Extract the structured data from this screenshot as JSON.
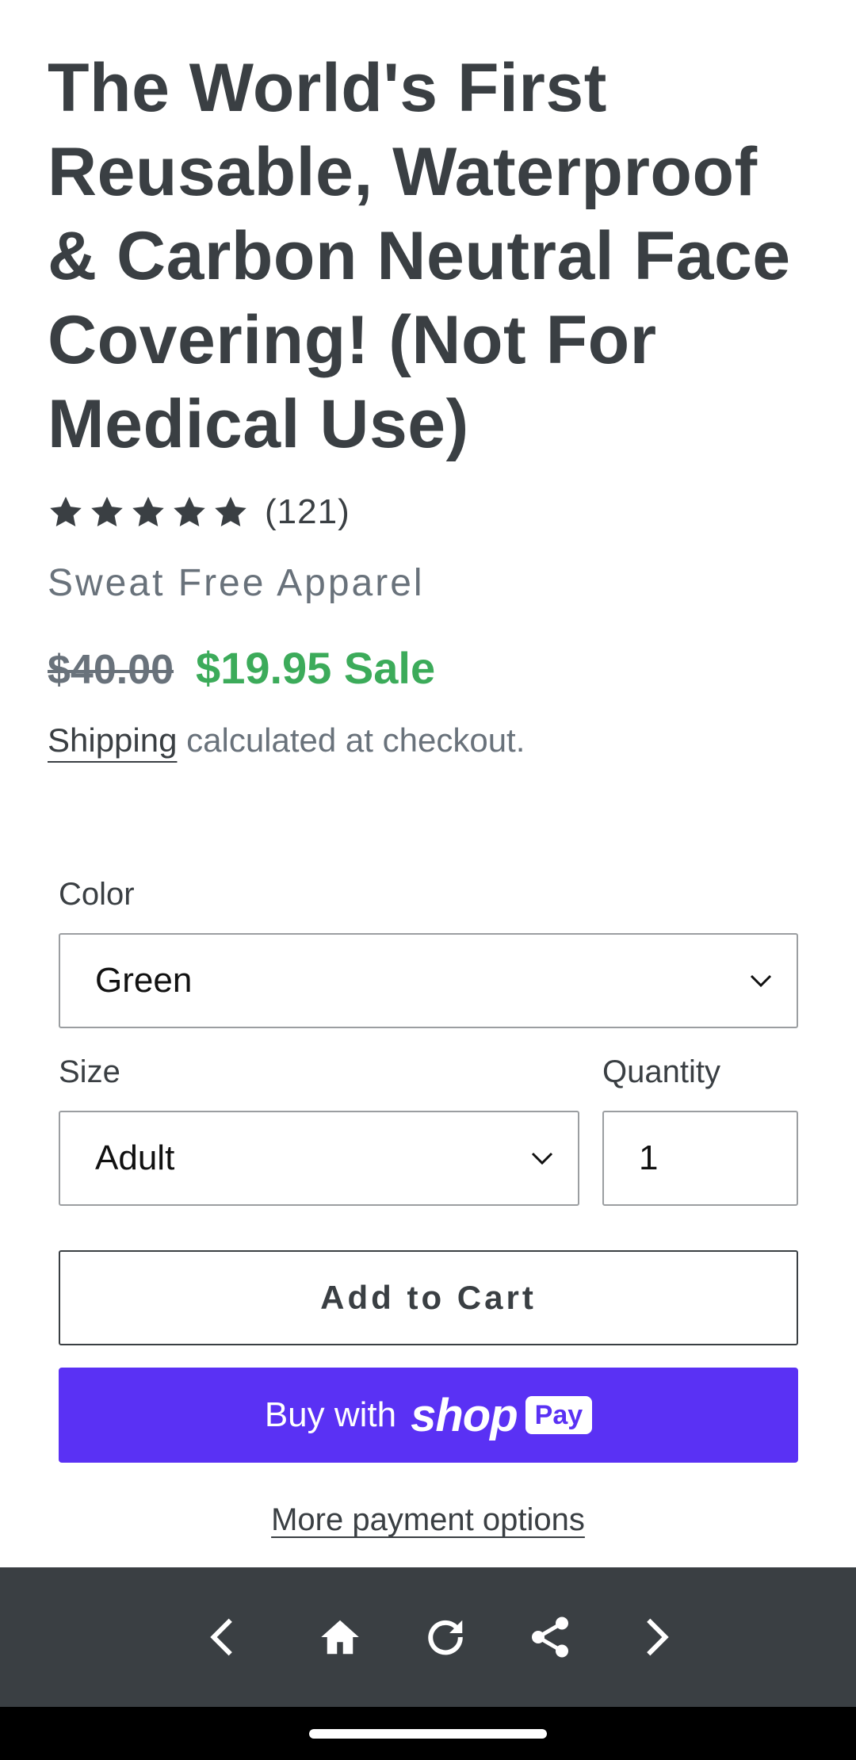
{
  "product": {
    "title": "The World's First Reusable, Waterproof & Carbon Neutral Face Covering! (Not For Medical Use)",
    "rating_stars": 5,
    "rating_count": "(121)",
    "vendor": "Sweat Free Apparel",
    "compare_price": "$40.00",
    "sale_price": "$19.95 Sale",
    "shipping_link": "Shipping",
    "shipping_text": " calculated at checkout."
  },
  "options": {
    "color_label": "Color",
    "color_value": "Green",
    "size_label": "Size",
    "size_value": "Adult",
    "quantity_label": "Quantity",
    "quantity_value": "1"
  },
  "actions": {
    "add_to_cart": "Add to Cart",
    "buy_with": "Buy with",
    "shop_word": "shop",
    "pay_badge": "Pay",
    "more_payment_options": "More payment options"
  },
  "nav": {
    "icons": [
      "back-icon",
      "home-icon",
      "reload-icon",
      "share-icon",
      "forward-icon"
    ]
  },
  "colors": {
    "text": "#3a3f43",
    "muted": "#69727b",
    "sale": "#3cab5a",
    "shop_pay": "#5a31f4",
    "nav_bar": "#3a3f43"
  }
}
